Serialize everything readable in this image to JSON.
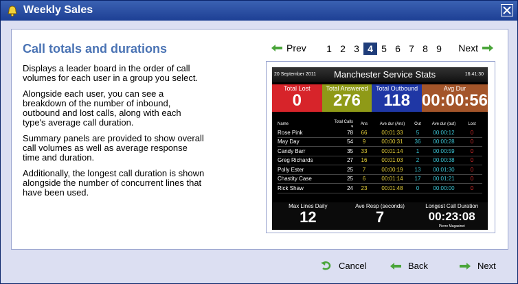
{
  "window": {
    "title": "Weekly Sales"
  },
  "page": {
    "heading": "Call totals and durations",
    "paragraphs": [
      "Displays a leader board in the order of call volumes for each user in a group you select.",
      "Alongside each user, you can see a breakdown of the number of inbound, outbound and lost calls, along with each type's average call duration.",
      "Summary panels are provided to show overall call volumes as well as average response time and duration.",
      "Additionally, the longest call duration is shown alongside the number of concurrent lines that have been used."
    ]
  },
  "pager": {
    "prev_label": "Prev",
    "next_label": "Next",
    "pages": [
      "1",
      "2",
      "3",
      "4",
      "5",
      "6",
      "7",
      "8",
      "9"
    ],
    "current": "4"
  },
  "board": {
    "date": "20 September 2011",
    "title": "Manchester Service Stats",
    "time": "16:41:30",
    "panels": [
      {
        "label": "Total Lost",
        "value": "0",
        "color": "#d7242a"
      },
      {
        "label": "Total Answered",
        "value": "276",
        "color": "#8f9a17"
      },
      {
        "label": "Total Outbound",
        "value": "118",
        "color": "#1f37a5"
      },
      {
        "label": "Avg Dur",
        "value": "00:00:56",
        "color": "#a3552a"
      }
    ],
    "columns": [
      "Name",
      "Total Calls ▾",
      "Ans",
      "Ave dur (Ans)",
      "Out",
      "Ave dur (out)",
      "Lost"
    ],
    "rows": [
      {
        "name": "Rose Pink",
        "total": "78",
        "ans": "66",
        "ans_dur": "00:01:33",
        "out": "5",
        "out_dur": "00:00:12",
        "lost": "0"
      },
      {
        "name": "May Day",
        "total": "54",
        "ans": "9",
        "ans_dur": "00:00:31",
        "out": "36",
        "out_dur": "00:00:28",
        "lost": "0"
      },
      {
        "name": "Candy Barr",
        "total": "35",
        "ans": "33",
        "ans_dur": "00:01:14",
        "out": "1",
        "out_dur": "00:00:59",
        "lost": "0"
      },
      {
        "name": "Greg Richards",
        "total": "27",
        "ans": "16",
        "ans_dur": "00:01:03",
        "out": "2",
        "out_dur": "00:00:38",
        "lost": "0"
      },
      {
        "name": "Polly Ester",
        "total": "25",
        "ans": "7",
        "ans_dur": "00:00:19",
        "out": "13",
        "out_dur": "00:01:30",
        "lost": "0"
      },
      {
        "name": "Chastity Case",
        "total": "25",
        "ans": "6",
        "ans_dur": "00:01:14",
        "out": "17",
        "out_dur": "00:01:21",
        "lost": "0"
      },
      {
        "name": "Rick Shaw",
        "total": "24",
        "ans": "23",
        "ans_dur": "00:01:48",
        "out": "0",
        "out_dur": "00:00:00",
        "lost": "0"
      }
    ],
    "bottom": [
      {
        "label": "Max Lines Daily",
        "value": "12",
        "sub": ""
      },
      {
        "label": "Ave Resp (seconds)",
        "value": "7",
        "sub": ""
      },
      {
        "label": "Longest Call Duration",
        "value": "00:23:08",
        "sub": "Pierre Magasinet"
      }
    ]
  },
  "footer": {
    "cancel_label": "Cancel",
    "back_label": "Back",
    "next_label": "Next"
  }
}
